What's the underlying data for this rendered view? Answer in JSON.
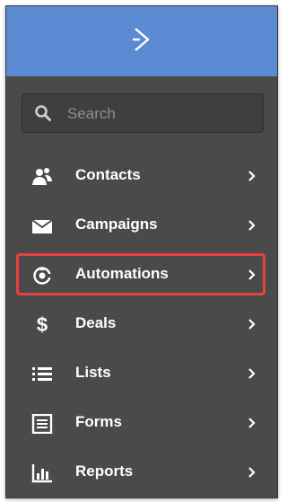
{
  "header": {
    "logo_icon": "activecampaign-chevron-icon",
    "brand_color": "#5a8bd3"
  },
  "search": {
    "placeholder": "Search",
    "value": "",
    "icon": "search-icon"
  },
  "nav": {
    "items": [
      {
        "label": "Contacts",
        "icon": "contacts-icon"
      },
      {
        "label": "Campaigns",
        "icon": "envelope-icon"
      },
      {
        "label": "Automations",
        "icon": "automations-icon",
        "highlighted": true
      },
      {
        "label": "Deals",
        "icon": "dollar-icon"
      },
      {
        "label": "Lists",
        "icon": "list-icon"
      },
      {
        "label": "Forms",
        "icon": "form-icon"
      },
      {
        "label": "Reports",
        "icon": "bar-chart-icon"
      }
    ]
  },
  "colors": {
    "sidebar_bg": "#4a4a4a",
    "highlight_border": "#e8413e",
    "text": "#ffffff"
  }
}
